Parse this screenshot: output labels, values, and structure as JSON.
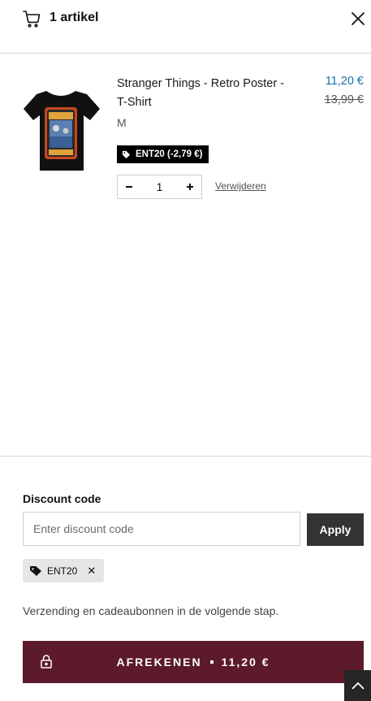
{
  "cart": {
    "title": "1 artikel",
    "close_icon": "close-icon",
    "cart_icon": "cart-icon"
  },
  "item": {
    "name": "Stranger Things - Retro Poster - T-Shirt",
    "variant": "M",
    "price_current": "11,20 €",
    "price_original": "13,99 €",
    "discount_badge": "ENT20 (-2,79 €)",
    "quantity": "1",
    "remove_label": "Verwijderen",
    "image_icon": "tshirt-image"
  },
  "discount": {
    "label": "Discount code",
    "placeholder": "Enter discount code",
    "apply_label": "Apply",
    "applied_code": "ENT20"
  },
  "shipping_note": "Verzending en cadeaubonnen in de volgende stap.",
  "checkout": {
    "label": "AFREKENEN",
    "total": "11,20 €"
  },
  "colors": {
    "accent_price": "#1a6fa8",
    "checkout_bg": "#5c1a2b",
    "apply_bg": "#333333"
  }
}
